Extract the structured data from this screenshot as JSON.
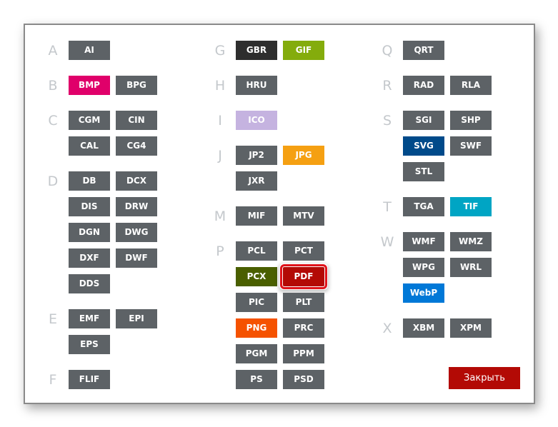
{
  "groups": [
    {
      "letter": "A",
      "formats": [
        {
          "label": "AI",
          "color": "#5d6266"
        }
      ]
    },
    {
      "letter": "B",
      "formats": [
        {
          "label": "BMP",
          "color": "#e0006a"
        },
        {
          "label": "BPG",
          "color": "#5d6266"
        }
      ]
    },
    {
      "letter": "C",
      "formats": [
        {
          "label": "CGM",
          "color": "#5d6266"
        },
        {
          "label": "CIN",
          "color": "#5d6266"
        },
        {
          "label": "CAL",
          "color": "#5d6266"
        },
        {
          "label": "CG4",
          "color": "#5d6266"
        }
      ]
    },
    {
      "letter": "D",
      "formats": [
        {
          "label": "DB",
          "color": "#5d6266"
        },
        {
          "label": "DCX",
          "color": "#5d6266"
        },
        {
          "label": "DIS",
          "color": "#5d6266"
        },
        {
          "label": "DRW",
          "color": "#5d6266"
        },
        {
          "label": "DGN",
          "color": "#5d6266"
        },
        {
          "label": "DWG",
          "color": "#5d6266"
        },
        {
          "label": "DXF",
          "color": "#5d6266"
        },
        {
          "label": "DWF",
          "color": "#5d6266"
        },
        {
          "label": "DDS",
          "color": "#5d6266"
        }
      ]
    },
    {
      "letter": "E",
      "formats": [
        {
          "label": "EMF",
          "color": "#5d6266"
        },
        {
          "label": "EPI",
          "color": "#5d6266"
        },
        {
          "label": "EPS",
          "color": "#5d6266"
        }
      ]
    },
    {
      "letter": "F",
      "formats": [
        {
          "label": "FLIF",
          "color": "#5d6266"
        }
      ]
    },
    {
      "letter": "G",
      "formats": [
        {
          "label": "GBR",
          "color": "#2e2e2e"
        },
        {
          "label": "GIF",
          "color": "#84ac0c"
        }
      ]
    },
    {
      "letter": "H",
      "formats": [
        {
          "label": "HRU",
          "color": "#5d6266"
        }
      ]
    },
    {
      "letter": "I",
      "formats": [
        {
          "label": "ICO",
          "color": "#c5b3e0"
        }
      ]
    },
    {
      "letter": "J",
      "formats": [
        {
          "label": "JP2",
          "color": "#5d6266"
        },
        {
          "label": "JPG",
          "color": "#f5a012"
        },
        {
          "label": "JXR",
          "color": "#5d6266"
        }
      ]
    },
    {
      "letter": "M",
      "formats": [
        {
          "label": "MIF",
          "color": "#5d6266"
        },
        {
          "label": "MTV",
          "color": "#5d6266"
        }
      ]
    },
    {
      "letter": "P",
      "formats": [
        {
          "label": "PCL",
          "color": "#5d6266"
        },
        {
          "label": "PCT",
          "color": "#5d6266"
        },
        {
          "label": "PCX",
          "color": "#4a5f00"
        },
        {
          "label": "PDF",
          "color": "#b30a05",
          "selected": true
        },
        {
          "label": "PIC",
          "color": "#5d6266"
        },
        {
          "label": "PLT",
          "color": "#5d6266"
        },
        {
          "label": "PNG",
          "color": "#f55200"
        },
        {
          "label": "PRC",
          "color": "#5d6266"
        },
        {
          "label": "PGM",
          "color": "#5d6266"
        },
        {
          "label": "PPM",
          "color": "#5d6266"
        },
        {
          "label": "PS",
          "color": "#5d6266"
        },
        {
          "label": "PSD",
          "color": "#5d6266"
        }
      ]
    },
    {
      "letter": "Q",
      "formats": [
        {
          "label": "QRT",
          "color": "#5d6266"
        }
      ]
    },
    {
      "letter": "R",
      "formats": [
        {
          "label": "RAD",
          "color": "#5d6266"
        },
        {
          "label": "RLA",
          "color": "#5d6266"
        }
      ]
    },
    {
      "letter": "S",
      "formats": [
        {
          "label": "SGI",
          "color": "#5d6266"
        },
        {
          "label": "SHP",
          "color": "#5d6266"
        },
        {
          "label": "SVG",
          "color": "#004a8a"
        },
        {
          "label": "SWF",
          "color": "#5d6266"
        },
        {
          "label": "STL",
          "color": "#5d6266"
        }
      ]
    },
    {
      "letter": "T",
      "formats": [
        {
          "label": "TGA",
          "color": "#5d6266"
        },
        {
          "label": "TIF",
          "color": "#00a5c4"
        }
      ]
    },
    {
      "letter": "W",
      "formats": [
        {
          "label": "WMF",
          "color": "#5d6266"
        },
        {
          "label": "WMZ",
          "color": "#5d6266"
        },
        {
          "label": "WPG",
          "color": "#5d6266"
        },
        {
          "label": "WRL",
          "color": "#5d6266"
        },
        {
          "label": "WebP",
          "color": "#0078d7"
        }
      ]
    },
    {
      "letter": "X",
      "formats": [
        {
          "label": "XBM",
          "color": "#5d6266"
        },
        {
          "label": "XPM",
          "color": "#5d6266"
        }
      ]
    }
  ],
  "close_button": {
    "label": "Закрыть",
    "color": "#b30a05"
  }
}
